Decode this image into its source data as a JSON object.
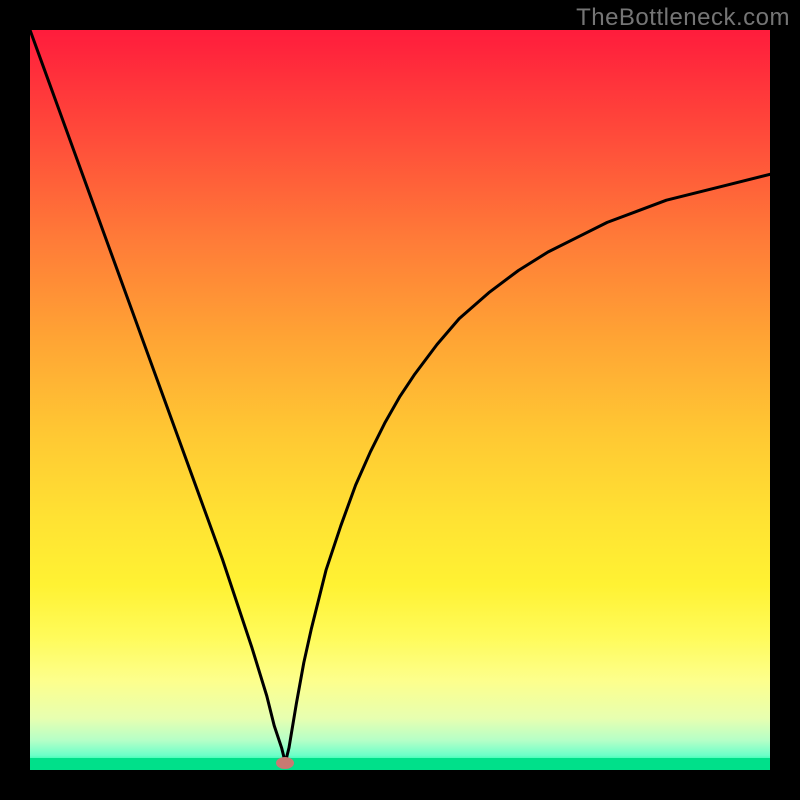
{
  "watermark": "TheBottleneck.com",
  "chart_data": {
    "type": "line",
    "title": "",
    "xlabel": "",
    "ylabel": "",
    "xlim": [
      0,
      100
    ],
    "ylim": [
      0,
      100
    ],
    "grid": false,
    "legend": false,
    "background": "gradient-red-yellow-green",
    "x": [
      0,
      2,
      4,
      6,
      8,
      10,
      12,
      14,
      16,
      18,
      20,
      22,
      24,
      26,
      28,
      30,
      32,
      33,
      34,
      34.5,
      35,
      36,
      37,
      38,
      40,
      42,
      44,
      46,
      48,
      50,
      52,
      55,
      58,
      62,
      66,
      70,
      74,
      78,
      82,
      86,
      90,
      94,
      100
    ],
    "values": [
      100,
      94.5,
      89,
      83.5,
      78,
      72.5,
      67,
      61.5,
      56,
      50.5,
      45,
      39.5,
      34,
      28.5,
      22.5,
      16.5,
      10,
      6,
      3,
      1,
      3,
      9,
      14.5,
      19,
      27,
      33,
      38.5,
      43,
      47,
      50.5,
      53.5,
      57.5,
      61,
      64.5,
      67.5,
      70,
      72,
      74,
      75.5,
      77,
      78,
      79,
      80.5
    ],
    "marker": {
      "x": 34.5,
      "y": 1,
      "color": "#c77a72"
    }
  }
}
